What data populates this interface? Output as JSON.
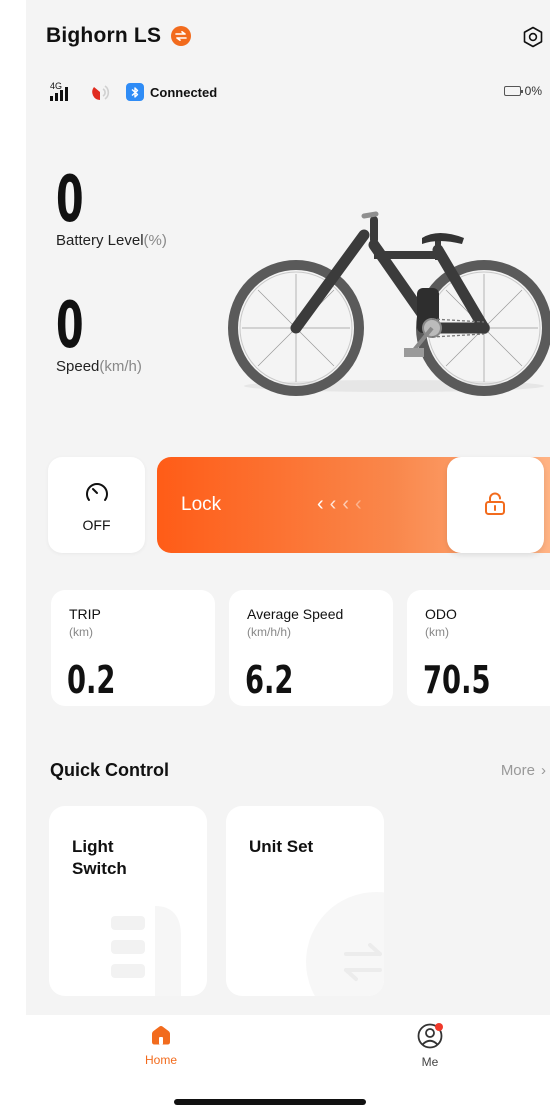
{
  "header": {
    "title": "Bighorn LS",
    "switch_icon": "swap-icon",
    "settings_icon": "settings-icon"
  },
  "status_bar": {
    "network": "4G",
    "bluetooth_status": "Connected",
    "battery_percent": "0%"
  },
  "metrics": {
    "battery": {
      "value": "0",
      "label": "Battery Level",
      "unit": "(%)"
    },
    "speed": {
      "value": "0",
      "label": "Speed",
      "unit": "(km/h)"
    }
  },
  "controls": {
    "speed_mode_label": "OFF",
    "lock_label": "Lock",
    "chevrons": [
      "‹",
      "‹",
      "‹",
      "‹"
    ]
  },
  "stats": [
    {
      "name": "TRIP",
      "unit": "(km)",
      "value": "0.2"
    },
    {
      "name": "Average Speed",
      "unit": "(km/h/h)",
      "value": "6.2"
    },
    {
      "name": "ODO",
      "unit": "(km)",
      "value": "70.5"
    }
  ],
  "quick_control": {
    "title": "Quick Control",
    "more_label": "More",
    "cards": [
      {
        "label": "Light Switch"
      },
      {
        "label": "Unit Set"
      }
    ]
  },
  "tabbar": {
    "tabs": [
      {
        "label": "Home",
        "active": true
      },
      {
        "label": "Me",
        "active": false
      }
    ]
  },
  "colors": {
    "accent": "#f26b1d",
    "bluetooth": "#2f8cf6",
    "background": "#f4f4f4"
  }
}
